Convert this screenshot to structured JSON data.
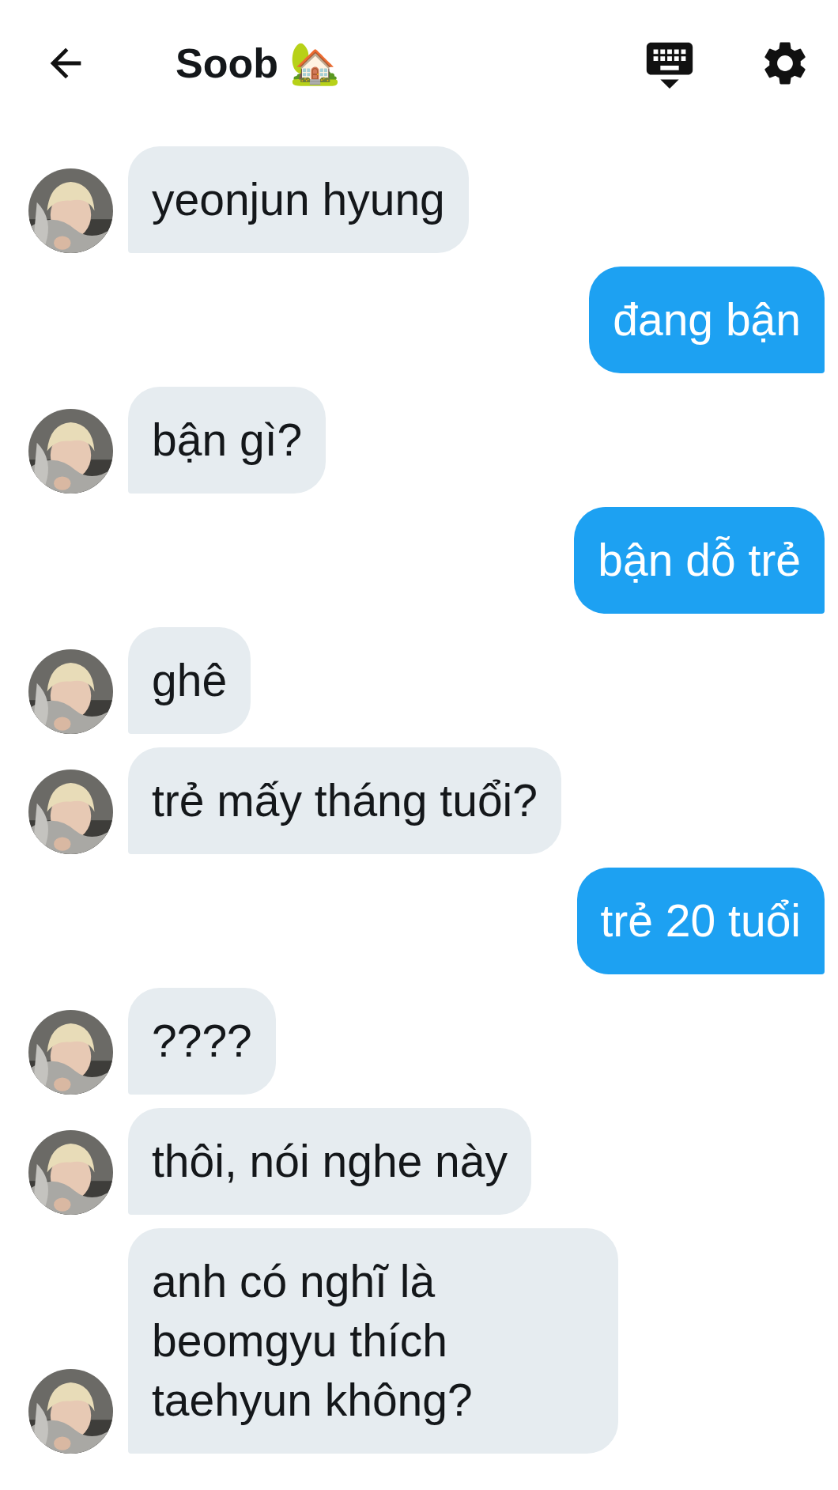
{
  "header": {
    "title": "Soob 🏡"
  },
  "messages": [
    {
      "kind": "incoming",
      "text": "yeonjun hyung"
    },
    {
      "kind": "outgoing",
      "text": "đang bận"
    },
    {
      "kind": "incoming",
      "text": "bận gì?"
    },
    {
      "kind": "outgoing",
      "text": "bận dỗ trẻ"
    },
    {
      "kind": "incoming",
      "text": "ghê"
    },
    {
      "kind": "incoming",
      "text": "trẻ mấy tháng tuổi?"
    },
    {
      "kind": "outgoing",
      "text": "trẻ 20 tuổi"
    },
    {
      "kind": "incoming",
      "text": "????"
    },
    {
      "kind": "incoming",
      "text": "thôi, nói nghe này"
    },
    {
      "kind": "incoming",
      "text": "anh có nghĩ là beomgyu thích taehyun không?"
    }
  ]
}
